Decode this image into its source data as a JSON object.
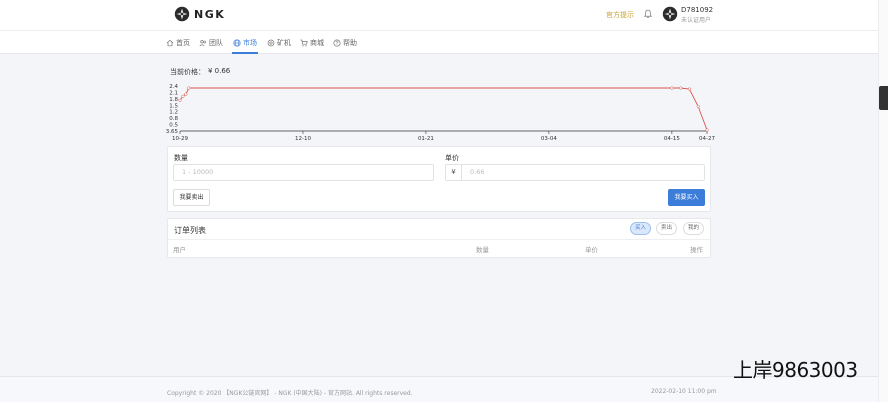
{
  "header": {
    "brand": "NGK",
    "notice_link": "官方提示",
    "user_id": "D781092",
    "user_status": "未认证用户"
  },
  "nav": {
    "items": [
      {
        "label": "首页",
        "icon": "home-icon"
      },
      {
        "label": "团队",
        "icon": "team-icon"
      },
      {
        "label": "市场",
        "icon": "globe-icon",
        "active": true
      },
      {
        "label": "矿机",
        "icon": "miner-icon"
      },
      {
        "label": "商城",
        "icon": "cart-icon"
      },
      {
        "label": "帮助",
        "icon": "help-icon"
      }
    ]
  },
  "market": {
    "current_price_label": "当前价格：",
    "current_price_value": "¥ 0.66"
  },
  "chart_data": {
    "type": "line",
    "y_ticks": [
      "2.4",
      "2.1",
      "1.8",
      "1.5",
      "1.2",
      "0.8",
      "0.5",
      "3.65"
    ],
    "x_ticks": [
      "10-29",
      "12-10",
      "01-21",
      "03-04",
      "04-15",
      "04-27"
    ],
    "ylim": [
      0.3,
      2.5
    ],
    "series": [
      {
        "color": "#d9534f",
        "points": [
          [
            "10-29",
            1.8
          ],
          [
            "10-30",
            2.0
          ],
          [
            "10-31",
            2.1
          ],
          [
            "11-01",
            2.4
          ],
          [
            "04-15",
            2.4
          ],
          [
            "04-18",
            2.4
          ],
          [
            "04-21",
            2.35
          ],
          [
            "04-24",
            1.5
          ],
          [
            "04-27",
            0.35
          ]
        ]
      }
    ]
  },
  "form": {
    "quantity_label": "数量",
    "quantity_placeholder": "1 - 10000",
    "unit_price_label": "单价",
    "currency_prefix": "¥",
    "unit_price_placeholder": "0.66",
    "sell_button": "我要卖出",
    "buy_button": "我要买入"
  },
  "orders": {
    "title": "订单列表",
    "filters": [
      {
        "label": "买入",
        "active": true
      },
      {
        "label": "卖出",
        "active": false
      },
      {
        "label": "我的",
        "active": false
      }
    ],
    "columns": [
      "用户",
      "数量",
      "单价",
      "操作"
    ]
  },
  "footer": {
    "copyright": "Copyright © 2020 【NGK公链官网】 - NGK (中国大陆) - 官方网站. All rights reserved.",
    "timestamp": "2022-02-10 11:00 pm"
  },
  "watermark": "上岸9863003",
  "colors": {
    "accent": "#3b7dd8",
    "line": "#d9534f",
    "notice": "#c9a23a"
  }
}
